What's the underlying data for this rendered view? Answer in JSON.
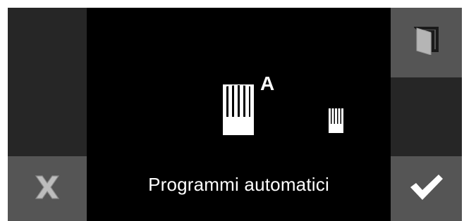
{
  "screen": {
    "title": "Programmi automatici",
    "auto_badge": "A",
    "icons": {
      "large": "chef-hat-icon",
      "small": "chef-hat-icon"
    }
  },
  "buttons": {
    "cancel": {
      "icon": "close-icon"
    },
    "confirm": {
      "icon": "checkmark-icon"
    },
    "door": {
      "icon": "door-icon"
    }
  },
  "colors": {
    "background": "#000000",
    "panel_dark": "#262626",
    "panel_mid": "#555555",
    "icon": "#ffffff",
    "cancel_icon": "#b5b5b5"
  }
}
